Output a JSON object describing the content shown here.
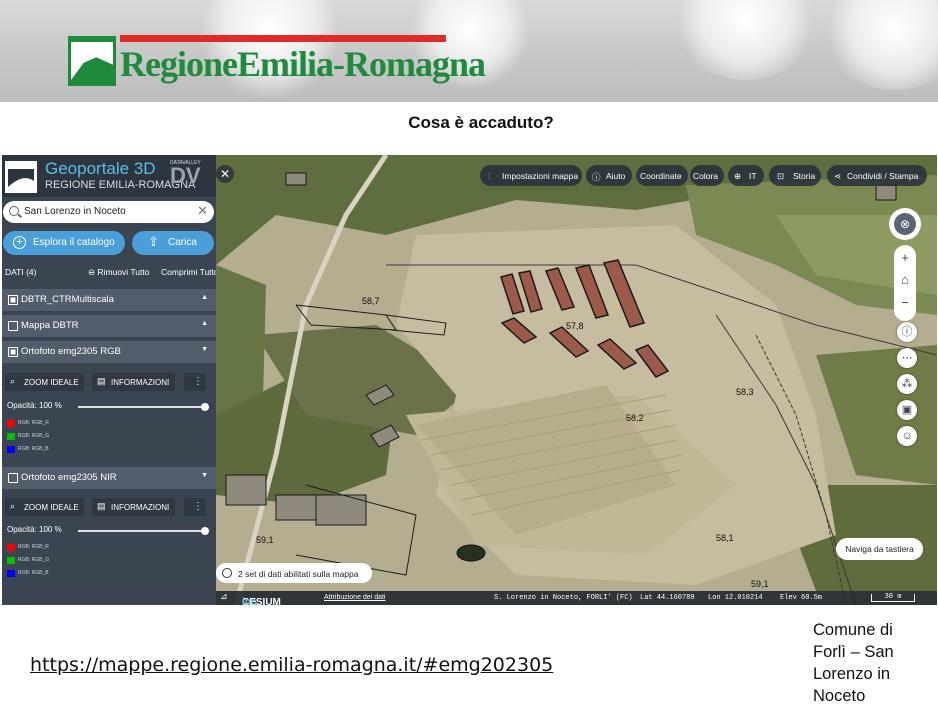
{
  "banner": {
    "org_name": "RegioneEmilia-Romagna",
    "question": "Cosa è accaduto?"
  },
  "app": {
    "title": "Geoportale 3D",
    "subtitle": "REGIONE EMILIA-ROMAGNA",
    "partner_top": "DATAVALLEY",
    "partner_big": "DV",
    "search_value": "San Lorenzo in Noceto",
    "buttons": {
      "catalog": "Esplora il catalogo",
      "upload": "Carica"
    },
    "data_header": {
      "title": "DATI (4)",
      "remove_all": "Rimuovi Tutto",
      "collapse_all": "Comprimi Tutto"
    },
    "layers": [
      {
        "name": "DBTR_CTRMultiscala",
        "checked": true,
        "caret": "▲"
      },
      {
        "name": "Mappa DBTR",
        "checked": false,
        "caret": "▲"
      },
      {
        "name": "Ortofoto emg2305 RGB",
        "checked": true,
        "caret": "▼",
        "zoom_label": "ZOOM IDEALE",
        "info_label": "INFORMAZIONI",
        "more": "⋮",
        "opacity_label": "Opacità: 100 %",
        "opacity": 1.0,
        "legend": [
          {
            "label": "RGB: RGB_R",
            "color": "#ff0000"
          },
          {
            "label": "RGB: RGB_G",
            "color": "#00c000"
          },
          {
            "label": "RGB: RGB_B",
            "color": "#0000ff"
          }
        ]
      },
      {
        "name": "Ortofoto emg2305 NIR",
        "checked": false,
        "caret": "▼",
        "zoom_label": "ZOOM IDEALE",
        "info_label": "INFORMAZIONI",
        "more": "⋮",
        "opacity_label": "Opacità: 100 %",
        "opacity": 1.0,
        "legend": [
          {
            "label": "RGB: RGB_R",
            "color": "#ff0000"
          },
          {
            "label": "RGB: RGB_G",
            "color": "#00c000"
          },
          {
            "label": "RGB: RGB_B",
            "color": "#0000ff"
          }
        ]
      }
    ],
    "toolbar": {
      "settings": "Impostazioni mappa",
      "help": "Aiuto",
      "coords": "Coordinate",
      "color": "Colora",
      "lang": "IT",
      "story": "Storia",
      "share": "Condividi / Stampa"
    },
    "map": {
      "close": "✕",
      "elevation_labels": [
        "58,2",
        "57,8",
        "58,7",
        "58,1",
        "58,3",
        "59,1",
        "59,1"
      ],
      "datasets_badge": "2 set di dati abilitati sulla mappa",
      "keyboard_nav": "Naviga da tastiera"
    },
    "status": {
      "cesium": "CESIUM",
      "ion": "ion",
      "attribution": "Attribuzione dei dati",
      "location": "S. Lorenzo in Noceto, FORLI' (FC)",
      "lat": "Lat  44.160789",
      "lon": "Lon  12.010214",
      "elev": "Elev  60.5m",
      "scale": "30 m"
    }
  },
  "footer": {
    "url": "https://mappe.regione.emilia-romagna.it/#emg202305",
    "caption": "Comune di Forlì – San Lorenzo in Noceto"
  }
}
